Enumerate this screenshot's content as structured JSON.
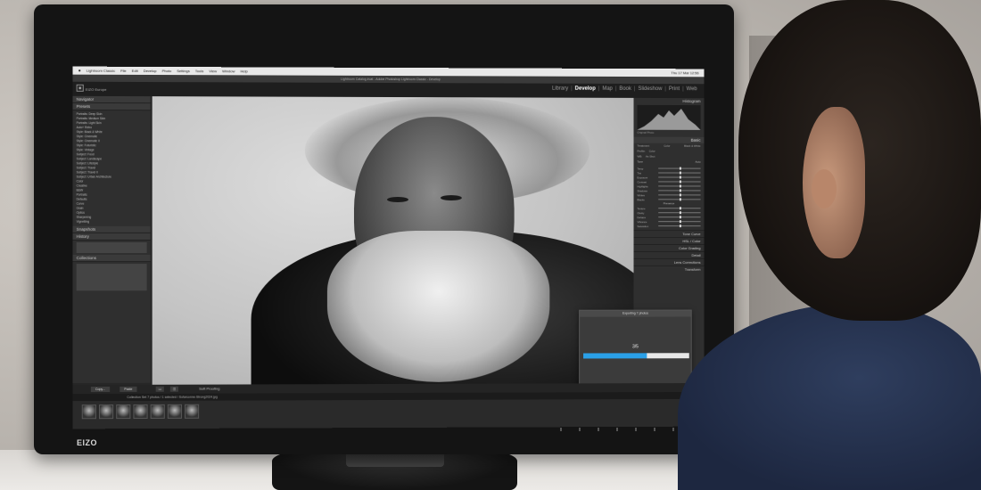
{
  "scene": {
    "description_brand": "EIZO"
  },
  "menubar": {
    "app": "Lightroom Classic",
    "items": [
      "File",
      "Edit",
      "Develop",
      "Photo",
      "Settings",
      "Tools",
      "View",
      "Window",
      "Help"
    ],
    "clock": "Thu 17 Mar 12:56"
  },
  "window_title": "Lightroom Catalog.lrcat - Adobe Photoshop Lightroom Classic - Develop",
  "header": {
    "logo": "EIZO Europe",
    "modules": [
      "Library",
      "Develop",
      "Map",
      "Book",
      "Slideshow",
      "Print",
      "Web"
    ],
    "active_module": "Develop"
  },
  "left_panel": {
    "navigator": "Navigator",
    "presets": "Presets",
    "preset_items": [
      "Portraits: Deep Skin",
      "Portraits: Medium Skin",
      "Portraits: Light Skin",
      "Auto+ Retro",
      "Style: Black & White",
      "Style: Cinematic",
      "Style: Cinematic II",
      "Style: Futuristic",
      "Style: Vintage",
      "Subject: Food",
      "Subject: Landscape",
      "Subject: Lifestyle",
      "Subject: Travel",
      "Subject: Travel II",
      "Subject: Urban Architecture",
      "Color",
      "Creative",
      "B&W",
      "Portraits",
      "Defaults",
      "Curve",
      "Grain",
      "Optics",
      "Sharpening",
      "Vignetting"
    ],
    "snapshots": "Snapshots",
    "history": "History",
    "collections": "Collections",
    "copy_button": "Copy...",
    "paste_button": "Paste"
  },
  "right_panel": {
    "histogram": "Histogram",
    "original_photo": "Original Photo",
    "basic": "Basic",
    "treatment": "Treatment:",
    "treatment_options": [
      "Color",
      "Black & White"
    ],
    "profile": "Profile:",
    "profile_value": "Color",
    "wb": "WB:",
    "wb_value": "As Shot",
    "tone": "Tone",
    "auto": "Auto",
    "sliders": [
      "Temp",
      "Tint",
      "Exposure",
      "Contrast",
      "Highlights",
      "Shadows",
      "Whites",
      "Blacks",
      "Texture",
      "Clarity",
      "Dehaze",
      "Vibrance",
      "Saturation"
    ],
    "presence": "Presence",
    "sections": [
      "Tone Curve",
      "HSL / Color",
      "Color Grading",
      "Detail",
      "Lens Corrections",
      "Transform"
    ]
  },
  "dialog": {
    "title": "Exporting 7 photos",
    "count": "3/5",
    "progress": 0.6
  },
  "toolbar": {
    "soft_proofing": "Soft Proofing"
  },
  "filmstrip": {
    "info": "Collection Set   7 photos / 1 selected / Sofarsonne-Strong2024.jpg",
    "thumb_count": 7
  }
}
